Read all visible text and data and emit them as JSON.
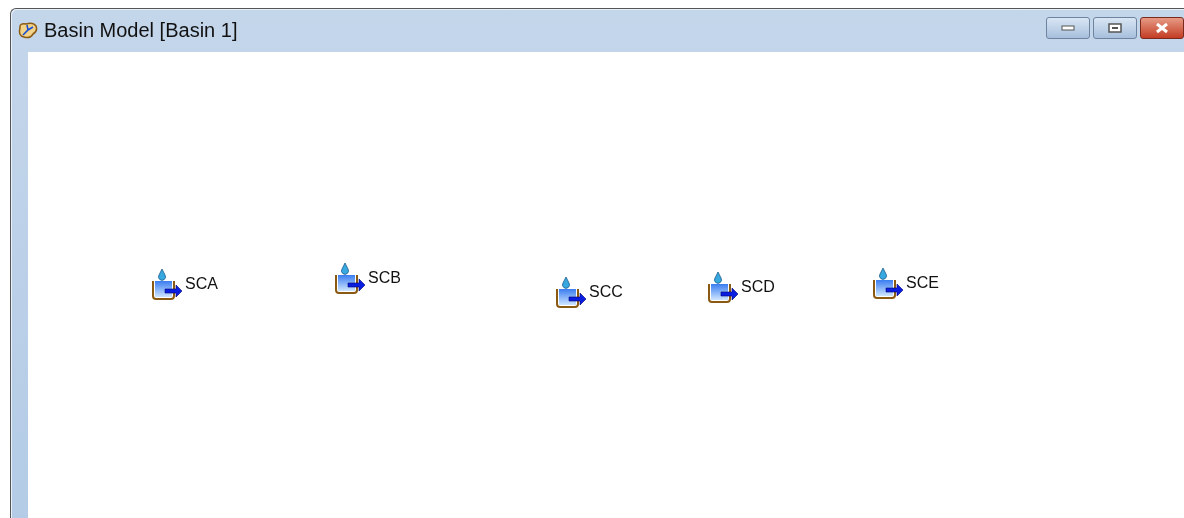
{
  "window": {
    "title": "Basin Model [Basin 1]"
  },
  "elements": [
    {
      "name": "SCA",
      "kind": "subbasin"
    },
    {
      "name": "SCB",
      "kind": "subbasin"
    },
    {
      "name": "SCC",
      "kind": "subbasin"
    },
    {
      "name": "SCD",
      "kind": "subbasin"
    },
    {
      "name": "SCE",
      "kind": "subbasin"
    }
  ]
}
